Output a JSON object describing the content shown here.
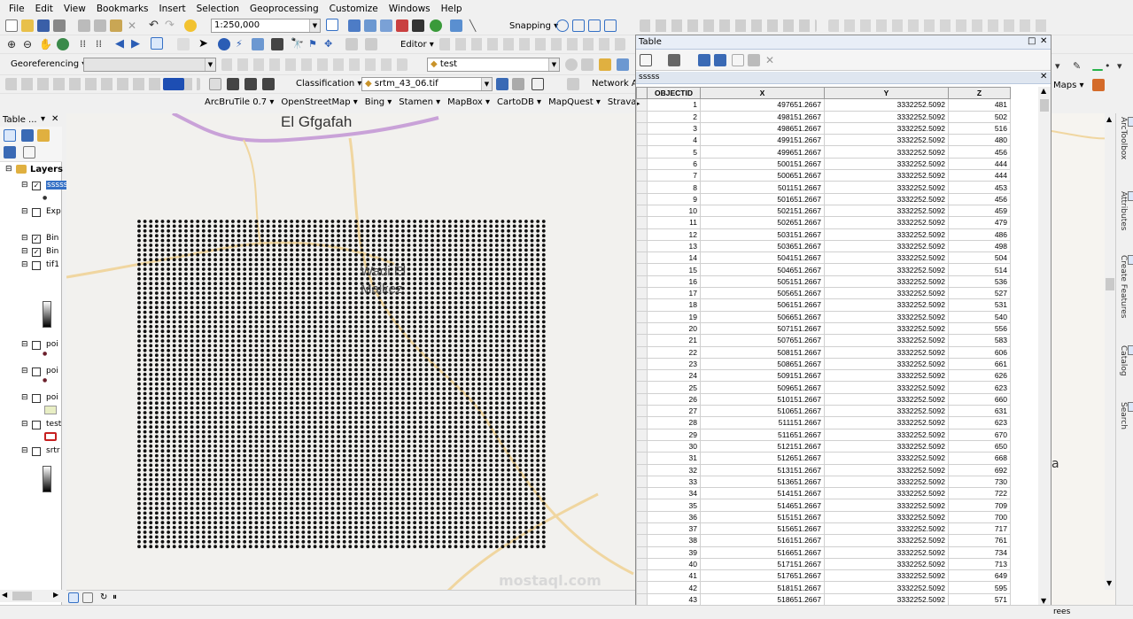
{
  "menu": [
    "File",
    "Edit",
    "View",
    "Bookmarks",
    "Insert",
    "Selection",
    "Geoprocessing",
    "Customize",
    "Windows",
    "Help"
  ],
  "toolbar": {
    "scale": "1:250,000",
    "snapping": "Snapping",
    "editor": "Editor",
    "georeferencing": "Georeferencing",
    "georef_layer": "",
    "layer_combo": "test",
    "classification": "Classification",
    "raster_combo": "srtm_43_06.tif",
    "network": "Network A",
    "maps": "Maps",
    "basemaps": [
      "ArcBruTile 0.7",
      "OpenStreetMap",
      "Bing",
      "Stamen",
      "MapBox",
      "CartoDB",
      "MapQuest",
      "Strava"
    ]
  },
  "toc": {
    "title": "Table ...",
    "root": "Layers",
    "layers": [
      {
        "name": "sssss",
        "checked": true,
        "selected": true
      },
      {
        "name": "Exp",
        "checked": false
      },
      {
        "name": "Bin",
        "checked": true
      },
      {
        "name": "Bin",
        "checked": true
      },
      {
        "name": "tif1",
        "checked": false
      },
      {
        "name": "poi",
        "checked": false
      },
      {
        "name": "poi",
        "checked": false
      },
      {
        "name": "poi",
        "checked": false
      },
      {
        "name": "test",
        "checked": false
      },
      {
        "name": "srtr",
        "checked": false
      }
    ]
  },
  "map": {
    "labels": [
      "El Gfgafah",
      "Wadi El",
      "Malkez"
    ],
    "watermark": "mostaql.com"
  },
  "table": {
    "window_title": "Table",
    "tab_name": "sssss",
    "columns": [
      "OBJECTID",
      "X",
      "Y",
      "Z"
    ],
    "rows": [
      [
        1,
        "497651.2667",
        "3332252.5092",
        481
      ],
      [
        2,
        "498151.2667",
        "3332252.5092",
        502
      ],
      [
        3,
        "498651.2667",
        "3332252.5092",
        516
      ],
      [
        4,
        "499151.2667",
        "3332252.5092",
        480
      ],
      [
        5,
        "499651.2667",
        "3332252.5092",
        456
      ],
      [
        6,
        "500151.2667",
        "3332252.5092",
        444
      ],
      [
        7,
        "500651.2667",
        "3332252.5092",
        444
      ],
      [
        8,
        "501151.2667",
        "3332252.5092",
        453
      ],
      [
        9,
        "501651.2667",
        "3332252.5092",
        456
      ],
      [
        10,
        "502151.2667",
        "3332252.5092",
        459
      ],
      [
        11,
        "502651.2667",
        "3332252.5092",
        479
      ],
      [
        12,
        "503151.2667",
        "3332252.5092",
        486
      ],
      [
        13,
        "503651.2667",
        "3332252.5092",
        498
      ],
      [
        14,
        "504151.2667",
        "3332252.5092",
        504
      ],
      [
        15,
        "504651.2667",
        "3332252.5092",
        514
      ],
      [
        16,
        "505151.2667",
        "3332252.5092",
        536
      ],
      [
        17,
        "505651.2667",
        "3332252.5092",
        527
      ],
      [
        18,
        "506151.2667",
        "3332252.5092",
        531
      ],
      [
        19,
        "506651.2667",
        "3332252.5092",
        540
      ],
      [
        20,
        "507151.2667",
        "3332252.5092",
        556
      ],
      [
        21,
        "507651.2667",
        "3332252.5092",
        583
      ],
      [
        22,
        "508151.2667",
        "3332252.5092",
        606
      ],
      [
        23,
        "508651.2667",
        "3332252.5092",
        661
      ],
      [
        24,
        "509151.2667",
        "3332252.5092",
        626
      ],
      [
        25,
        "509651.2667",
        "3332252.5092",
        623
      ],
      [
        26,
        "510151.2667",
        "3332252.5092",
        660
      ],
      [
        27,
        "510651.2667",
        "3332252.5092",
        631
      ],
      [
        28,
        "511151.2667",
        "3332252.5092",
        623
      ],
      [
        29,
        "511651.2667",
        "3332252.5092",
        670
      ],
      [
        30,
        "512151.2667",
        "3332252.5092",
        650
      ],
      [
        31,
        "512651.2667",
        "3332252.5092",
        668
      ],
      [
        32,
        "513151.2667",
        "3332252.5092",
        692
      ],
      [
        33,
        "513651.2667",
        "3332252.5092",
        730
      ],
      [
        34,
        "514151.2667",
        "3332252.5092",
        722
      ],
      [
        35,
        "514651.2667",
        "3332252.5092",
        709
      ],
      [
        36,
        "515151.2667",
        "3332252.5092",
        700
      ],
      [
        37,
        "515651.2667",
        "3332252.5092",
        717
      ],
      [
        38,
        "516151.2667",
        "3332252.5092",
        761
      ],
      [
        39,
        "516651.2667",
        "3332252.5092",
        734
      ],
      [
        40,
        "517151.2667",
        "3332252.5092",
        713
      ],
      [
        41,
        "517651.2667",
        "3332252.5092",
        649
      ],
      [
        42,
        "518151.2667",
        "3332252.5092",
        595
      ],
      [
        43,
        "518651.2667",
        "3332252.5092",
        571
      ]
    ]
  },
  "side_tabs": [
    "ArcToolbox",
    "Attributes",
    "Create Features",
    "Catalog",
    "Search"
  ],
  "right_panel": {
    "fragment_a": "a",
    "status_fragment": "rees"
  }
}
